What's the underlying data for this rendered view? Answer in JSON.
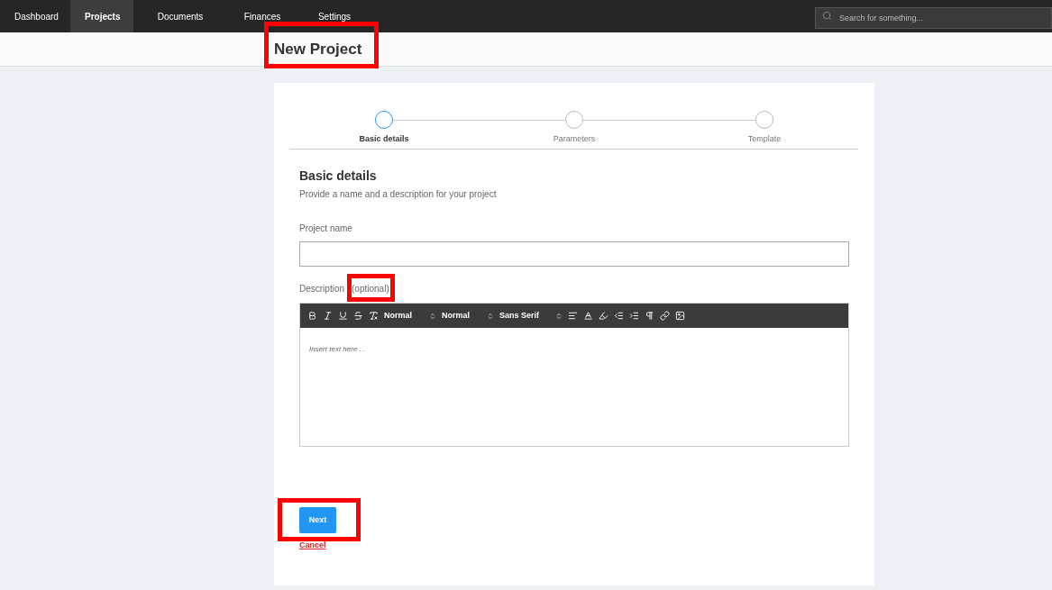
{
  "nav": {
    "items": [
      {
        "label": "Dashboard",
        "selected": false
      },
      {
        "label": "Projects",
        "selected": true
      },
      {
        "label": "Documents",
        "selected": false
      },
      {
        "label": "Finances",
        "selected": false
      },
      {
        "label": "Settings",
        "selected": false
      }
    ],
    "search": {
      "placeholder": "Search for something..."
    }
  },
  "page_title": {
    "text": "New Project",
    "highlighted": true
  },
  "stepper": [
    {
      "label": "Basic details",
      "selected": true
    },
    {
      "label": "Parameters",
      "selected": false
    },
    {
      "label": "Template",
      "selected": false
    }
  ],
  "section": {
    "title": "Basic details",
    "subtitle": "Provide a name and a description for your project"
  },
  "fields": {
    "name_label": "Project name",
    "description_label": "Description",
    "description_note": {
      "text": "(optional)",
      "highlighted": true
    }
  },
  "editor": {
    "selects": [
      "Normal",
      "Normal",
      "Sans Serif"
    ],
    "placeholder": "Insert text here ..."
  },
  "actions": {
    "next": {
      "label": "Next",
      "highlighted": true
    },
    "cancel": "Cancel"
  }
}
